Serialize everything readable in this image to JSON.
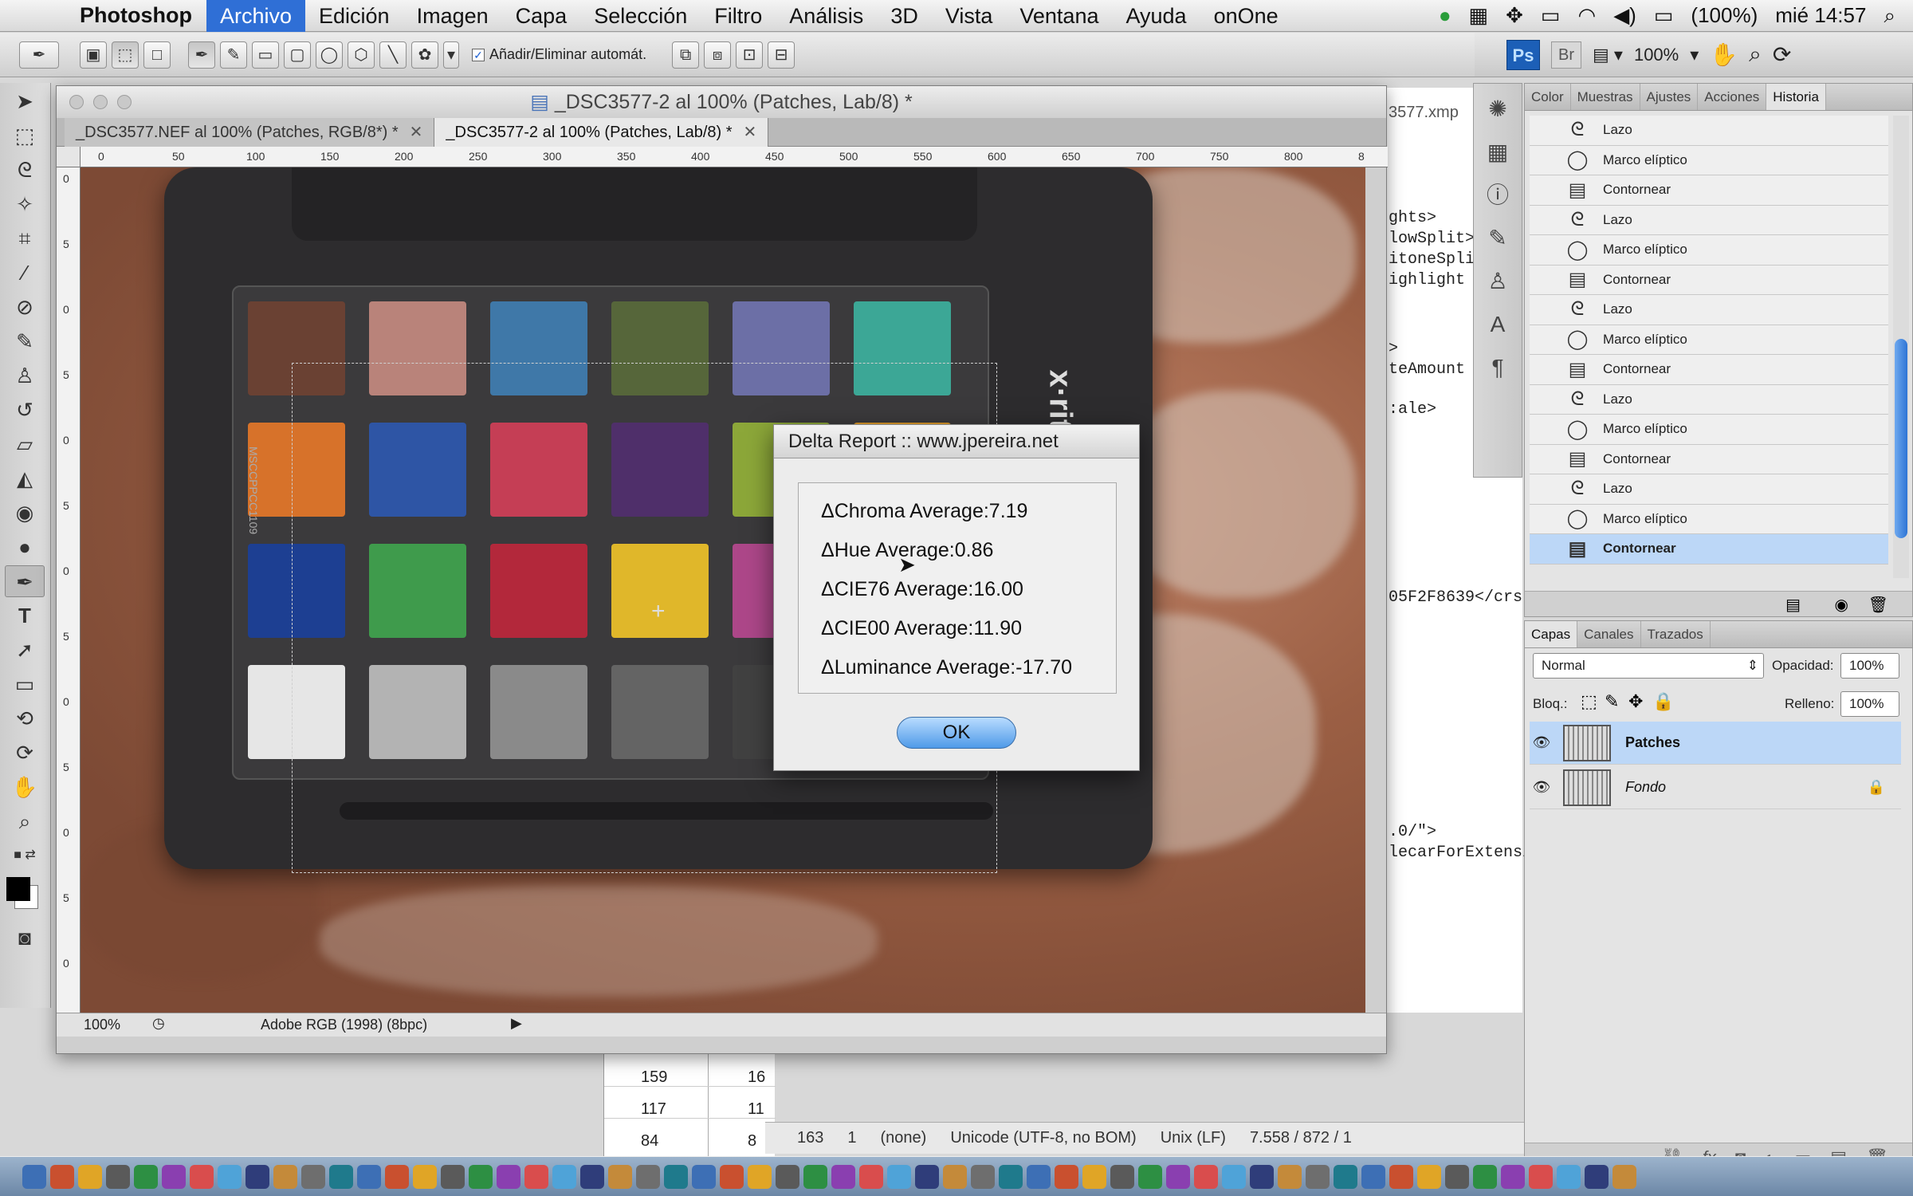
{
  "menubar": {
    "app_name": "Photoshop",
    "items": [
      "Archivo",
      "Edición",
      "Imagen",
      "Capa",
      "Selección",
      "Filtro",
      "Análisis",
      "3D",
      "Vista",
      "Ventana",
      "Ayuda",
      "onOne"
    ],
    "battery": "(100%)",
    "clock": "mié 14:57"
  },
  "options_bar": {
    "auto_add_delete_label": "Añadir/Eliminar automát.",
    "auto_add_delete_checked": true
  },
  "app_bar": {
    "ps_badge": "Ps",
    "br_badge": "Br",
    "zoom": "100%"
  },
  "document": {
    "window_title": "_DSC3577-2 al 100% (Patches, Lab/8) *",
    "tabs": [
      {
        "label": "_DSC3577.NEF al 100% (Patches, RGB/8*) *",
        "active": false
      },
      {
        "label": "_DSC3577-2 al 100% (Patches, Lab/8) *",
        "active": true
      }
    ],
    "ruler_h": [
      "0",
      "50",
      "100",
      "150",
      "200",
      "250",
      "300",
      "350",
      "400",
      "450",
      "500",
      "550",
      "600",
      "650",
      "700",
      "750",
      "800",
      "8"
    ],
    "ruler_v": [
      "0",
      "5",
      "0",
      "5",
      "0",
      "5",
      "0",
      "5",
      "0",
      "5",
      "0",
      "5",
      "0"
    ],
    "zoom": "100%",
    "profile": "Adobe RGB (1998) (8bpc)",
    "checker_brand": "x·rite",
    "checker_code": "MSCCPPCC1109",
    "patches": [
      "#6a4133",
      "#b9837a",
      "#3f78a8",
      "#56663a",
      "#6c6fa6",
      "#3ca796",
      "#d7722a",
      "#2e55a5",
      "#c53e55",
      "#4f2f6a",
      "#8ca739",
      "#dc9a2b",
      "#1d3f92",
      "#3f9b4c",
      "#b3283b",
      "#e0b72a",
      "#ad4789",
      "#1f86a4",
      "#e6e6e6",
      "#b3b3b3",
      "#8a8a8a",
      "#646464",
      "#414141",
      "#242424"
    ]
  },
  "dialog": {
    "title": "Delta Report :: www.jpereira.net",
    "lines": [
      "ΔChroma Average:7.19",
      "ΔHue Average:0.86",
      "ΔCIE76 Average:16.00",
      "ΔCIE00 Average:11.90",
      "ΔLuminance Average:-17.70"
    ],
    "ok_label": "OK"
  },
  "background_editor": {
    "filename_fragment": "3577.xmp",
    "code_lines": [
      "ghts>",
      "lowSplit>",
      "itoneSpli",
      "ighlight",
      ">",
      "teAmount",
      ":ale>",
      "05F2F8639</crs:",
      ".0/\">",
      "lecarForExtensi"
    ],
    "table": [
      [
        "159",
        "16"
      ],
      [
        "117",
        "11"
      ],
      [
        "84",
        "8"
      ]
    ],
    "status": {
      "line": "163",
      "col": "1",
      "syntax": "(none)",
      "encoding": "Unicode (UTF-8, no BOM)",
      "line_endings": "Unix (LF)",
      "stats": "7.558 / 872 / 1"
    }
  },
  "history_panel": {
    "tabs": [
      "Color",
      "Muestras",
      "Ajustes",
      "Acciones",
      "Historia"
    ],
    "active_tab": "Historia",
    "items": [
      {
        "label": "Lazo",
        "icon": "lasso-icon"
      },
      {
        "label": "Marco elíptico",
        "icon": "ellipse-icon"
      },
      {
        "label": "Contornear",
        "icon": "stroke-icon"
      },
      {
        "label": "Lazo",
        "icon": "lasso-icon"
      },
      {
        "label": "Marco elíptico",
        "icon": "ellipse-icon"
      },
      {
        "label": "Contornear",
        "icon": "stroke-icon"
      },
      {
        "label": "Lazo",
        "icon": "lasso-icon"
      },
      {
        "label": "Marco elíptico",
        "icon": "ellipse-icon"
      },
      {
        "label": "Contornear",
        "icon": "stroke-icon"
      },
      {
        "label": "Lazo",
        "icon": "lasso-icon"
      },
      {
        "label": "Marco elíptico",
        "icon": "ellipse-icon"
      },
      {
        "label": "Contornear",
        "icon": "stroke-icon"
      },
      {
        "label": "Lazo",
        "icon": "lasso-icon"
      },
      {
        "label": "Marco elíptico",
        "icon": "ellipse-icon"
      },
      {
        "label": "Contornear",
        "icon": "stroke-icon"
      }
    ],
    "selected_index": 14
  },
  "layers_panel": {
    "tabs": [
      "Capas",
      "Canales",
      "Trazados"
    ],
    "active_tab": "Capas",
    "blend_mode": "Normal",
    "opacity_label": "Opacidad:",
    "opacity_value": "100%",
    "lock_label": "Bloq.:",
    "fill_label": "Relleno:",
    "fill_value": "100%",
    "layers": [
      {
        "name": "Patches",
        "selected": true,
        "locked": false
      },
      {
        "name": "Fondo",
        "selected": false,
        "locked": true
      }
    ]
  },
  "colors": {
    "accent": "#2f6fd6",
    "selection": "#bcd7f7"
  }
}
